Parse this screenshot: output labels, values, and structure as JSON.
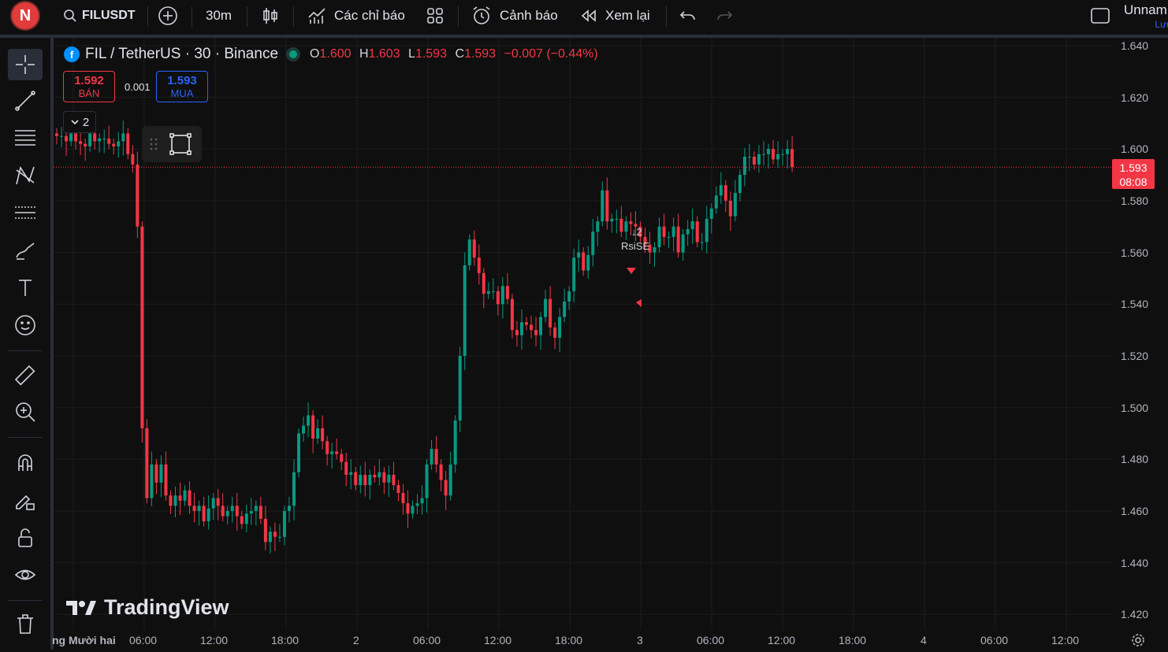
{
  "toolbar": {
    "avatar_letter": "N",
    "symbol": "FILUSDT",
    "interval": "30m",
    "indicators_label": "Các chỉ báo",
    "alerts_label": "Cảnh báo",
    "replay_label": "Xem lại",
    "layout_name": "Unnam",
    "save_label": "Lưu"
  },
  "legend": {
    "title": "FIL / TetherUS · 30 · Binance",
    "o_key": "O",
    "o_val": "1.600",
    "h_key": "H",
    "h_val": "1.603",
    "l_key": "L",
    "l_val": "1.593",
    "c_key": "C",
    "c_val": "1.593",
    "change": "−0.007 (−0.44%)"
  },
  "trade": {
    "sell_price": "1.592",
    "sell_label": "BÁN",
    "spread": "0.001",
    "buy_price": "1.593",
    "buy_label": "MUA"
  },
  "indicator_collapse": "2",
  "annotation": {
    "count": "2",
    "label": "RsiSE"
  },
  "last_price": {
    "price": "1.593",
    "countdown": "08:08"
  },
  "logo_text": "TradingView",
  "colors": {
    "up": "#089981",
    "down": "#f23645",
    "bg": "#0f0f0f",
    "grid": "#1c1c1c",
    "accent": "#2962ff"
  },
  "chart_data": {
    "type": "candlestick",
    "title": "FIL / TetherUS · 30 · Binance",
    "y_ticks": [
      "1.640",
      "1.620",
      "1.600",
      "1.580",
      "1.560",
      "1.540",
      "1.520",
      "1.500",
      "1.480",
      "1.460",
      "1.440",
      "1.420"
    ],
    "x_ticks": [
      "ng Mười hai",
      "06:00",
      "12:00",
      "18:00",
      "2",
      "06:00",
      "12:00",
      "18:00",
      "3",
      "06:00",
      "12:00",
      "18:00",
      "4",
      "06:00",
      "12:00"
    ],
    "ylim": [
      1.414,
      1.643
    ],
    "grid": true,
    "last_price": 1.593,
    "closes": [
      1.605,
      1.605,
      1.603,
      1.606,
      1.603,
      1.602,
      1.601,
      1.606,
      1.603,
      1.604,
      1.604,
      1.602,
      1.601,
      1.603,
      1.606,
      1.598,
      1.594,
      1.57,
      1.492,
      1.465,
      1.478,
      1.471,
      1.478,
      1.466,
      1.462,
      1.466,
      1.464,
      1.468,
      1.462,
      1.46,
      1.462,
      1.456,
      1.461,
      1.465,
      1.462,
      1.458,
      1.46,
      1.462,
      1.458,
      1.455,
      1.459,
      1.46,
      1.462,
      1.457,
      1.448,
      1.452,
      1.45,
      1.45,
      1.46,
      1.462,
      1.475,
      1.49,
      1.493,
      1.497,
      1.488,
      1.492,
      1.487,
      1.482,
      1.483,
      1.482,
      1.479,
      1.474,
      1.475,
      1.47,
      1.474,
      1.47,
      1.474,
      1.473,
      1.475,
      1.471,
      1.474,
      1.47,
      1.467,
      1.463,
      1.459,
      1.462,
      1.463,
      1.465,
      1.478,
      1.484,
      1.478,
      1.472,
      1.466,
      1.478,
      1.495,
      1.52,
      1.555,
      1.565,
      1.558,
      1.552,
      1.544,
      1.545,
      1.545,
      1.54,
      1.547,
      1.542,
      1.53,
      1.528,
      1.533,
      1.532,
      1.53,
      1.528,
      1.535,
      1.542,
      1.531,
      1.527,
      1.535,
      1.541,
      1.545,
      1.558,
      1.56,
      1.553,
      1.559,
      1.568,
      1.572,
      1.584,
      1.572,
      1.573,
      1.573,
      1.568,
      1.572,
      1.571,
      1.57,
      1.566,
      1.563,
      1.56,
      1.562,
      1.57,
      1.566,
      1.566,
      1.57,
      1.56,
      1.567,
      1.569,
      1.572,
      1.564,
      1.564,
      1.573,
      1.577,
      1.582,
      1.586,
      1.58,
      1.574,
      1.583,
      1.59,
      1.597,
      1.597,
      1.594,
      1.598,
      1.598,
      1.6,
      1.596,
      1.598,
      1.598,
      1.6,
      1.593
    ]
  }
}
